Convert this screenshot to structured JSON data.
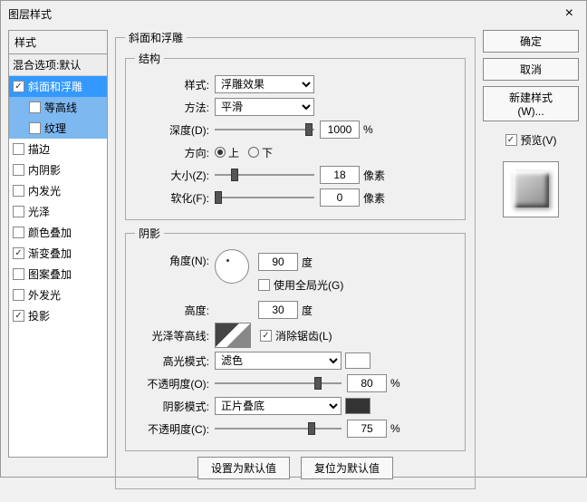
{
  "title": "图层样式",
  "styles": {
    "header": "样式",
    "mix": "混合选项:默认",
    "items": [
      {
        "label": "斜面和浮雕",
        "checked": true,
        "sel": true
      },
      {
        "label": "等高线",
        "checked": false,
        "sub": true
      },
      {
        "label": "纹理",
        "checked": false,
        "sub": true
      },
      {
        "label": "描边",
        "checked": false
      },
      {
        "label": "内阴影",
        "checked": false
      },
      {
        "label": "内发光",
        "checked": false
      },
      {
        "label": "光泽",
        "checked": false
      },
      {
        "label": "颜色叠加",
        "checked": false
      },
      {
        "label": "渐变叠加",
        "checked": true
      },
      {
        "label": "图案叠加",
        "checked": false
      },
      {
        "label": "外发光",
        "checked": false
      },
      {
        "label": "投影",
        "checked": true
      }
    ]
  },
  "bevel": {
    "legend": "斜面和浮雕",
    "struct_legend": "结构",
    "style_lbl": "样式:",
    "style_val": "浮雕效果",
    "tech_lbl": "方法:",
    "tech_val": "平滑",
    "depth_lbl": "深度(D):",
    "depth_val": "1000",
    "depth_unit": "%",
    "dir_lbl": "方向:",
    "up": "上",
    "down": "下",
    "size_lbl": "大小(Z):",
    "size_val": "18",
    "size_unit": "像素",
    "soft_lbl": "软化(F):",
    "soft_val": "0",
    "soft_unit": "像素"
  },
  "shade": {
    "legend": "阴影",
    "angle_lbl": "角度(N):",
    "angle_val": "90",
    "angle_unit": "度",
    "global_lbl": "使用全局光(G)",
    "alt_lbl": "高度:",
    "alt_val": "30",
    "alt_unit": "度",
    "gloss_lbl": "光泽等高线:",
    "anti_lbl": "消除锯齿(L)",
    "hmode_lbl": "高光模式:",
    "hmode_val": "滤色",
    "hop_lbl": "不透明度(O):",
    "hop_val": "80",
    "hop_unit": "%",
    "smode_lbl": "阴影模式:",
    "smode_val": "正片叠底",
    "sop_lbl": "不透明度(C):",
    "sop_val": "75",
    "sop_unit": "%"
  },
  "footer": {
    "default": "设置为默认值",
    "reset": "复位为默认值"
  },
  "right": {
    "ok": "确定",
    "cancel": "取消",
    "newstyle": "新建样式(W)...",
    "preview": "预览(V)"
  }
}
